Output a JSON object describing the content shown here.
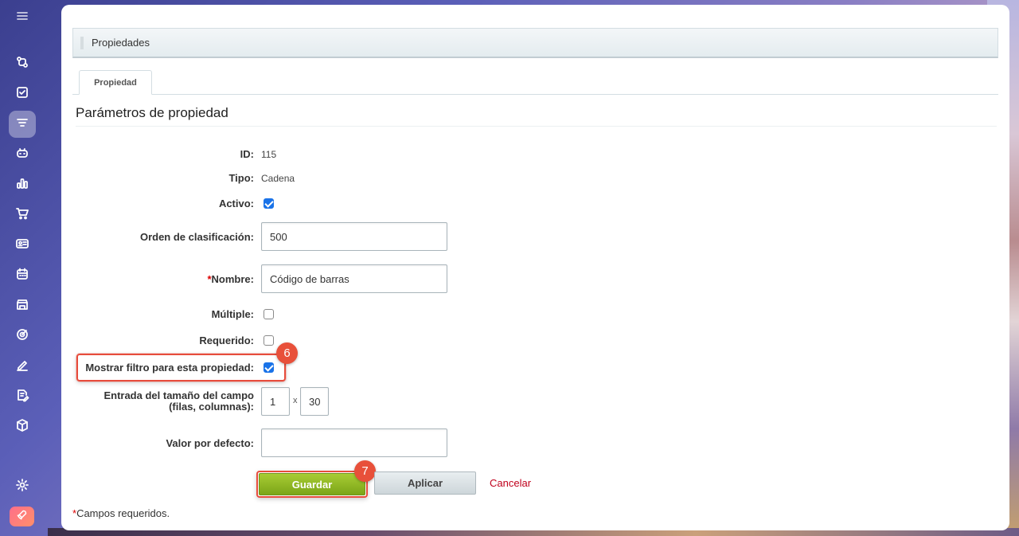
{
  "sidebar": {
    "icons": [
      "menu-icon",
      "flow-icon",
      "tasks-icon",
      "catalog-icon",
      "robot-icon",
      "analytics-icon",
      "cart-icon",
      "contact-card-icon",
      "calendar-icon",
      "store-icon",
      "target-icon",
      "sign-icon",
      "document-edit-icon",
      "box-icon",
      "settings-icon",
      "rocket-icon"
    ]
  },
  "header": {
    "title": "Propiedades"
  },
  "tabs": [
    {
      "label": "Propiedad",
      "active": true
    }
  ],
  "section": {
    "title": "Parámetros de propiedad"
  },
  "form": {
    "id_label": "ID:",
    "id_value": "115",
    "type_label": "Tipo:",
    "type_value": "Cadena",
    "active_label": "Activo:",
    "active_checked": true,
    "sort_label": "Orden de clasificación:",
    "sort_value": "500",
    "name_required_mark": "*",
    "name_label": "Nombre:",
    "name_value": "Código de barras",
    "multiple_label": "Múltiple:",
    "multiple_checked": false,
    "required_label": "Requerido:",
    "required_checked": false,
    "filter_label": "Mostrar filtro para esta propiedad:",
    "filter_checked": true,
    "size_label_line1": "Entrada del tamaño del campo",
    "size_label_line2": "(filas, columnas):",
    "rows_value": "1",
    "size_separator": "x",
    "cols_value": "30",
    "default_label": "Valor por defecto:",
    "default_value": ""
  },
  "annotations": {
    "badge_filter": "6",
    "badge_save": "7"
  },
  "buttons": {
    "save": "Guardar",
    "apply": "Aplicar",
    "cancel": "Cancelar"
  },
  "footnote": {
    "mark": "*",
    "text": "Campos requeridos."
  },
  "colors": {
    "accent_green": "#8fb824",
    "highlight_red": "#e74c3c",
    "checkbox_blue": "#1a73e8",
    "cancel_red": "#c0001c"
  }
}
